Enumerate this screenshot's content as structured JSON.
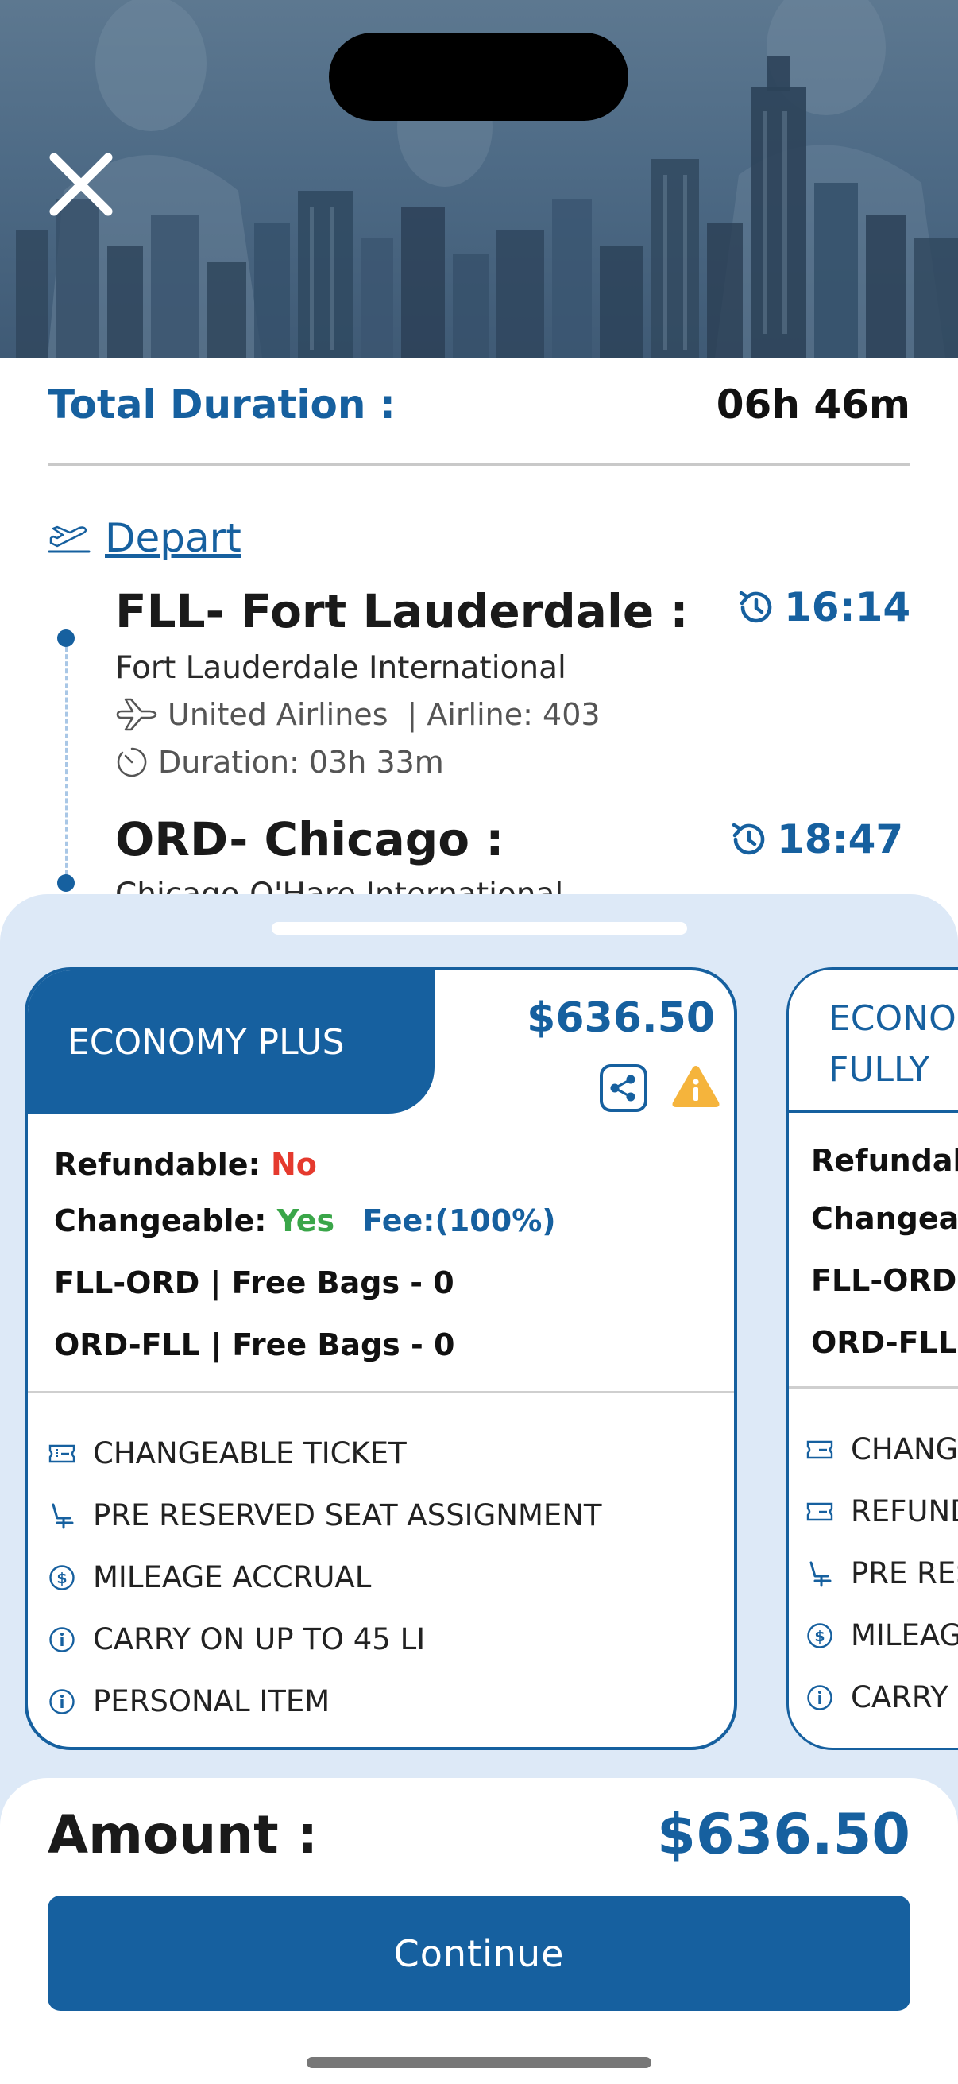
{
  "header": {
    "close_icon": "close-icon"
  },
  "summary": {
    "total_duration_label": "Total Duration :",
    "total_duration_value": "06h 46m"
  },
  "depart": {
    "label": "Depart",
    "icon": "plane-takeoff-icon"
  },
  "segments": [
    {
      "title": "FLL- Fort Lauderdale :",
      "time": "16:14",
      "airport": "Fort Lauderdale International",
      "airline": "United Airlines",
      "flight": "| Airline: 403",
      "duration": "Duration: 03h 33m"
    },
    {
      "title": "ORD- Chicago :",
      "time": "18:47",
      "airport": "Chicago O'Hare International"
    }
  ],
  "fares": [
    {
      "name": "ECONOMY PLUS",
      "price": "$636.50",
      "refundable_label": "Refundable:",
      "refundable_value": "No",
      "changeable_label": "Changeable:",
      "changeable_value": "Yes",
      "changeable_fee": "Fee:(100%)",
      "bags": [
        "FLL-ORD | Free Bags - 0",
        "ORD-FLL | Free Bags - 0"
      ],
      "features": [
        {
          "icon": "ticket-icon",
          "label": "CHANGEABLE TICKET"
        },
        {
          "icon": "seat-icon",
          "label": "PRE RESERVED SEAT ASSIGNMENT"
        },
        {
          "icon": "dollar-icon",
          "label": "MILEAGE ACCRUAL"
        },
        {
          "icon": "info-icon",
          "label": "CARRY ON UP TO 45 LI"
        },
        {
          "icon": "info-icon",
          "label": "PERSONAL ITEM"
        }
      ]
    },
    {
      "name_line1": "ECONO",
      "name_line2": "FULLY",
      "refundable_label": "Refundab",
      "changeable_label": "Changea",
      "bags": [
        "FLL-ORD |",
        "ORD-FLL |"
      ],
      "features": [
        {
          "icon": "ticket-icon",
          "label": "CHANG"
        },
        {
          "icon": "ticket-icon",
          "label": "REFUND"
        },
        {
          "icon": "seat-icon",
          "label": "PRE RES"
        },
        {
          "icon": "dollar-icon",
          "label": "MILEAG"
        },
        {
          "icon": "info-icon",
          "label": "CARRY"
        }
      ]
    }
  ],
  "footer": {
    "amount_label": "Amount :",
    "amount_value": "$636.50",
    "continue_label": "Continue"
  },
  "colors": {
    "primary": "#16609f",
    "sheet_bg": "#dde9f7",
    "negative": "#e53a2e",
    "positive": "#3aa649",
    "warning": "#f5b43c"
  }
}
